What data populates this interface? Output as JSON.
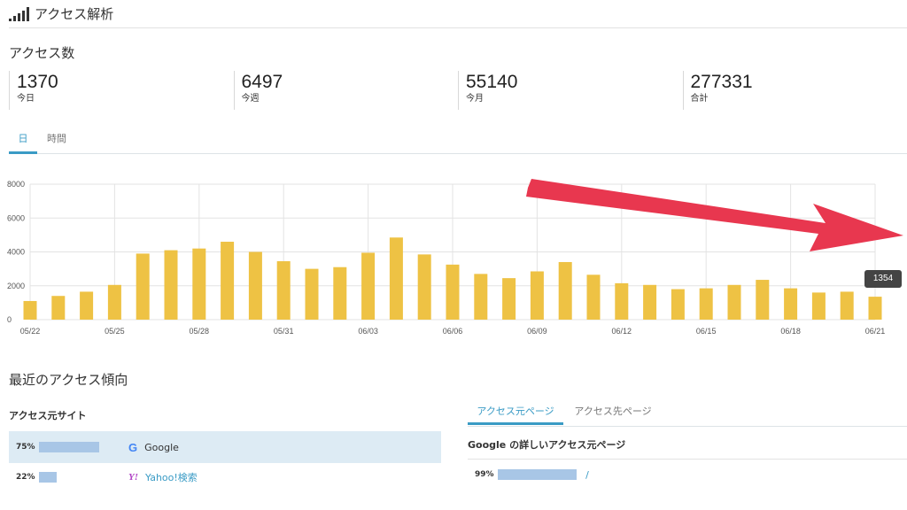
{
  "header": {
    "title": "アクセス解析",
    "icon": "signal-bars-icon"
  },
  "access_count": {
    "title": "アクセス数",
    "stats": [
      {
        "value": "1370",
        "label": "今日"
      },
      {
        "value": "6497",
        "label": "今週"
      },
      {
        "value": "55140",
        "label": "今月"
      },
      {
        "value": "277331",
        "label": "合計"
      }
    ]
  },
  "period_tabs": [
    {
      "label": "日",
      "active": true
    },
    {
      "label": "時間",
      "active": false
    }
  ],
  "chart_data": {
    "type": "bar",
    "categories": [
      "05/22",
      "05/23",
      "05/24",
      "05/25",
      "05/26",
      "05/27",
      "05/28",
      "05/29",
      "05/30",
      "05/31",
      "06/01",
      "06/02",
      "06/03",
      "06/04",
      "06/05",
      "06/06",
      "06/07",
      "06/08",
      "06/09",
      "06/10",
      "06/11",
      "06/12",
      "06/13",
      "06/14",
      "06/15",
      "06/16",
      "06/17",
      "06/18",
      "06/19",
      "06/20",
      "06/21"
    ],
    "values": [
      1100,
      1400,
      1650,
      2050,
      3900,
      4100,
      4200,
      4600,
      4000,
      3450,
      3000,
      3100,
      3950,
      4850,
      3850,
      3250,
      2700,
      2450,
      2850,
      3400,
      2650,
      2150,
      2050,
      1800,
      1850,
      2050,
      2350,
      1850,
      1600,
      1650,
      1354
    ],
    "x_tick_labels": [
      "05/22",
      "05/25",
      "05/28",
      "05/31",
      "06/03",
      "06/06",
      "06/09",
      "06/12",
      "06/15",
      "06/18",
      "06/21"
    ],
    "y_tick_labels": [
      "0",
      "2000",
      "4000",
      "6000",
      "8000"
    ],
    "ylim": [
      0,
      8000
    ],
    "grid": true,
    "bar_color": "#eec244",
    "tooltip": "1354"
  },
  "annotation": {
    "arrow_color": "#e8374f"
  },
  "recent": {
    "title": "最近のアクセス傾向",
    "source_sites": {
      "title": "アクセス元サイト",
      "rows": [
        {
          "percent": "75%",
          "fraction": 0.75,
          "name": "Google",
          "icon": "google-icon",
          "highlighted": true,
          "is_link": false
        },
        {
          "percent": "22%",
          "fraction": 0.22,
          "name": "Yahoo!検索",
          "icon": "yahoo-icon",
          "highlighted": false,
          "is_link": true
        }
      ]
    },
    "page_tabs": [
      {
        "label": "アクセス元ページ",
        "active": true
      },
      {
        "label": "アクセス先ページ",
        "active": false
      }
    ],
    "google_detail": {
      "title": "Google の詳しいアクセス元ページ",
      "rows": [
        {
          "percent": "99%",
          "fraction": 0.99,
          "path": "/"
        }
      ]
    }
  },
  "colors": {
    "accent": "#3a9bc5",
    "bar_fill": "#a8c6e6",
    "highlight": "#ddebf4"
  }
}
